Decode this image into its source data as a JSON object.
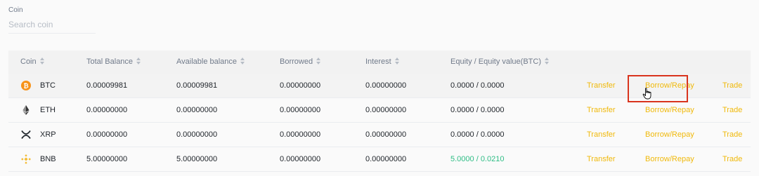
{
  "filter": {
    "label": "Coin",
    "placeholder": "Search coin"
  },
  "columns": [
    "Coin",
    "Total Balance",
    "Available balance",
    "Borrowed",
    "Interest",
    "Equity / Equity value(BTC)"
  ],
  "rows": [
    {
      "coin": "BTC",
      "icon": "btc-icon",
      "total": "0.00009981",
      "available": "0.00009981",
      "borrowed": "0.00000000",
      "interest": "0.00000000",
      "equity": "0.0000 / 0.0000"
    },
    {
      "coin": "ETH",
      "icon": "eth-icon",
      "total": "0.00000000",
      "available": "0.00000000",
      "borrowed": "0.00000000",
      "interest": "0.00000000",
      "equity": "0.0000 / 0.0000"
    },
    {
      "coin": "XRP",
      "icon": "xrp-icon",
      "total": "0.00000000",
      "available": "0.00000000",
      "borrowed": "0.00000000",
      "interest": "0.00000000",
      "equity": "0.0000 / 0.0000"
    },
    {
      "coin": "BNB",
      "icon": "bnb-icon",
      "total": "5.00000000",
      "available": "5.00000000",
      "borrowed": "0.00000000",
      "interest": "0.00000000",
      "equity": "5.0000 / 0.0210"
    }
  ],
  "actions": {
    "transfer": "Transfer",
    "borrow_repay": "Borrow/Repay",
    "trade": "Trade"
  },
  "colors": {
    "accent": "#f0b90b",
    "positive": "#2ebd85",
    "highlight": "#d9341d"
  }
}
